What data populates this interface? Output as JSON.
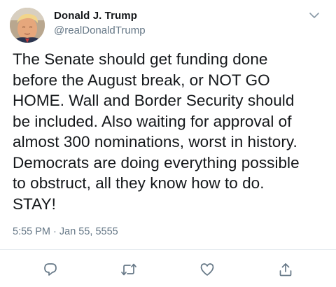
{
  "tweet": {
    "author_name": "Donald J. Trump",
    "author_handle": "@realDonaldTrump",
    "text": "The Senate should get funding done\nbefore the August break, or NOT GO\nHOME. Wall and Border Security should\nbe included. Also waiting for approval of\nalmost 300 nominations, worst in history.\nDemocrats are doing everything possible\nto obstruct, all they know how to do.\nSTAY!",
    "timestamp": "5:55 PM · Jan 55, 5555"
  },
  "icons": {
    "menu": "chevron-down-icon",
    "reply": "reply-icon",
    "retweet": "retweet-icon",
    "like": "heart-icon",
    "share": "share-icon"
  },
  "colors": {
    "text": "#14171a",
    "secondary": "#657786",
    "icon": "#657786",
    "divider": "#e6ecf0",
    "background": "#ffffff"
  }
}
